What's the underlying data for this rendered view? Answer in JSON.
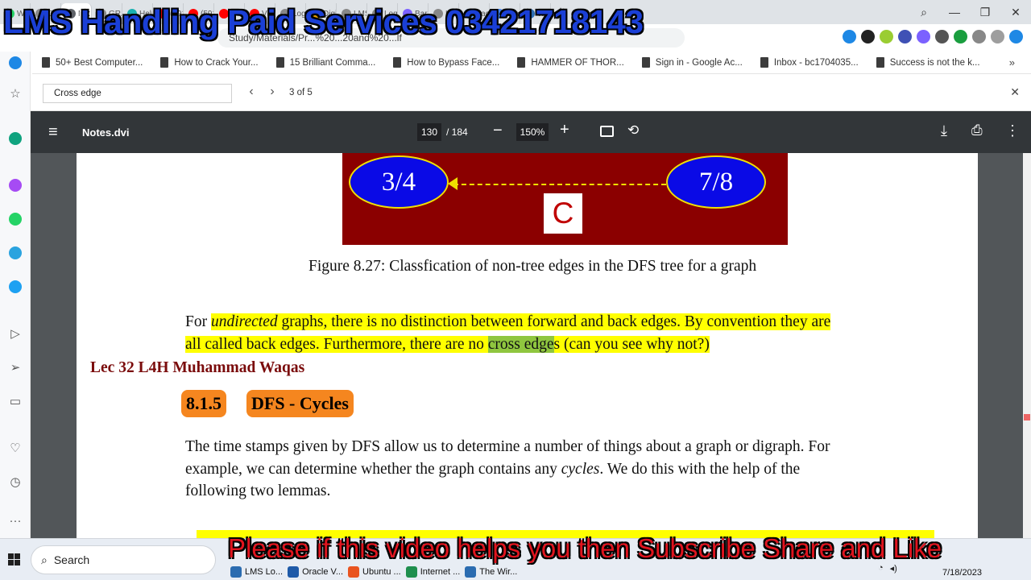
{
  "colors": {
    "banner_top": "#1a3fd6",
    "banner_bottom": "#e0141e",
    "figure_bg": "#8b0000",
    "node_fill": "#0a0ae6",
    "edge_color": "#f0e000",
    "highlight": "#ffff00",
    "highlight_match": "#8fc63f",
    "section_badge": "#f5861f",
    "lecture_note": "#7a0b0b"
  },
  "tabs": [
    {
      "label": "Wh",
      "color": "#25d366"
    },
    {
      "label": "Quiz",
      "color": "#888888"
    },
    {
      "label": "Nc",
      "color": "#5f6368",
      "active": true,
      "close": "✕"
    },
    {
      "label": "GRA",
      "color": "#888888"
    },
    {
      "label": "Help",
      "color": "#1ab1b1"
    },
    {
      "label": "(591",
      "color": "#ff0000"
    },
    {
      "label": "(591",
      "color": "#ff0000"
    },
    {
      "label": "Chan",
      "color": "#ff0000"
    },
    {
      "label": "Vide",
      "color": "#ff0000"
    },
    {
      "label": "Log",
      "color": "#888888"
    },
    {
      "label": "Digi",
      "color": "#e8a000"
    },
    {
      "label": "LMS",
      "color": "#888888"
    },
    {
      "label": "Log",
      "color": "#888888"
    },
    {
      "label": "Bard",
      "color": "#7b61ff"
    },
    {
      "label": "How",
      "color": "#888888"
    },
    {
      "label": "Face",
      "color": "#1877f2"
    },
    {
      "label": "Dow",
      "color": "#4285f4"
    },
    {
      "label": "Wire",
      "color": "#2b6cb0"
    }
  ],
  "new_tab": "+",
  "window_controls": {
    "search": "⌕",
    "minimize": "—",
    "restore": "❐",
    "close": "✕"
  },
  "banner": {
    "top": "LMS Handling Paid Services 03421718143",
    "bottom": "Please if this video helps you then Subscribe Share and Like"
  },
  "address_bar": {
    "url": "Study/Materials/Pr...%20...20and%20...lf"
  },
  "bookmarks": [
    {
      "label": "50+ Best Computer..."
    },
    {
      "label": "How to Crack Your..."
    },
    {
      "label": "15 Brilliant Comma..."
    },
    {
      "label": "How to Bypass Face..."
    },
    {
      "label": "HAMMER OF THOR..."
    },
    {
      "label": "Sign in - Google Ac..."
    },
    {
      "label": "Inbox - bc1704035..."
    },
    {
      "label": "Success is not the k..."
    }
  ],
  "bookmarks_more": "»",
  "find": {
    "value": "Cross edge",
    "count": "3 of 5",
    "prev": "‹",
    "next": "›",
    "close": "✕"
  },
  "pdf": {
    "title": "Notes.dvi",
    "page": "130",
    "page_total": "/ 184",
    "zoom": "150%",
    "zoom_out": "−",
    "zoom_in": "+",
    "rotate": "⟲",
    "download": "⤓",
    "print": "⎙",
    "more": "⋮",
    "menu": "≡"
  },
  "figure": {
    "node_left": "3/4",
    "node_right": "7/8",
    "edge_label": "C",
    "caption": "Figure 8.27: Classfication of non-tree edges in the DFS tree for a graph"
  },
  "para1": {
    "line1_a": "For ",
    "line1_b": "undirected",
    "line1_c": " graphs, there is no distinction between forward and back edges. By convention they are",
    "line2_a": "all called back edges. Furthermore, there are no ",
    "line2_match": "cross edge",
    "line2_b": "s (can you see why not?)"
  },
  "lecture_note": "Lec 32 L4H Muhammad Waqas",
  "section": {
    "number": "8.1.5",
    "title": "DFS - Cycles"
  },
  "para2": {
    "line1": "The time stamps given by DFS allow us to determine a number of things about a graph or digraph. For",
    "line2_a": "example, we can determine whether the graph contains any ",
    "line2_b": "cycles",
    "line2_c": ". We do this with the help of the",
    "line3": "following two lemmas."
  },
  "taskbar": {
    "search": "Search",
    "apps": [
      {
        "label": "LMS Lo...",
        "color": "#2b6cb0"
      },
      {
        "label": "Oracle V...",
        "color": "#1e5aa8"
      },
      {
        "label": "Ubuntu ...",
        "color": "#e95420"
      },
      {
        "label": "Internet ...",
        "color": "#1f8f4e"
      },
      {
        "label": "The Wir...",
        "color": "#2b6cb0"
      }
    ],
    "time": "7/18/2023"
  }
}
